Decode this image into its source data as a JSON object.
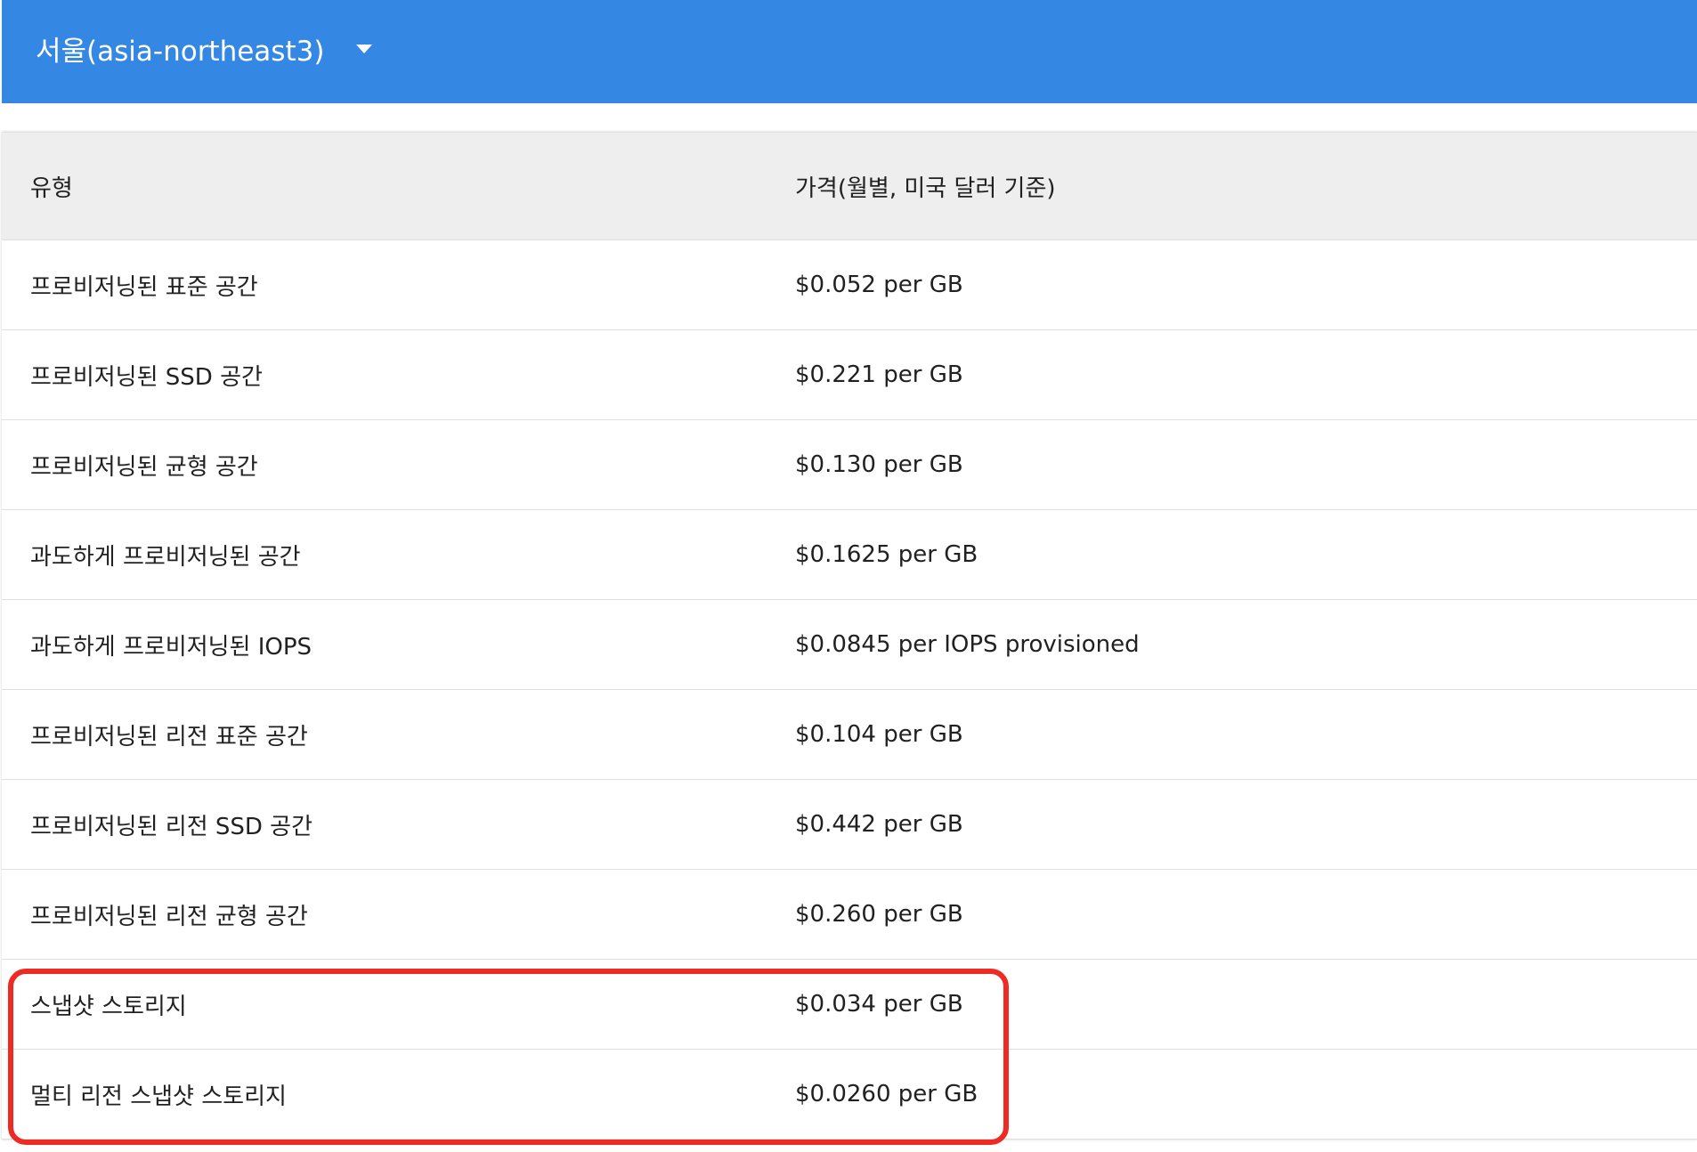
{
  "header": {
    "region": "서울(asia-northeast3)",
    "dropdown_icon": "caret-down-icon"
  },
  "table": {
    "columns": {
      "type": "유형",
      "price": "가격(월별, 미국 달러 기준)"
    },
    "rows": [
      {
        "type": "프로비저닝된 표준 공간",
        "price": "$0.052 per GB"
      },
      {
        "type": "프로비저닝된 SSD 공간",
        "price": "$0.221 per GB"
      },
      {
        "type": "프로비저닝된 균형 공간",
        "price": "$0.130 per GB"
      },
      {
        "type": "과도하게 프로비저닝된 공간",
        "price": "$0.1625 per GB"
      },
      {
        "type": "과도하게 프로비저닝된 IOPS",
        "price": "$0.0845 per IOPS provisioned"
      },
      {
        "type": "프로비저닝된 리전 표준 공간",
        "price": "$0.104 per GB"
      },
      {
        "type": "프로비저닝된 리전 SSD 공간",
        "price": "$0.442 per GB"
      },
      {
        "type": "프로비저닝된 리전 균형 공간",
        "price": "$0.260 per GB"
      },
      {
        "type": "스냅샷 스토리지",
        "price": "$0.034 per GB"
      },
      {
        "type": "멀티 리전 스냅샷 스토리지",
        "price": "$0.0260 per GB"
      }
    ]
  },
  "colors": {
    "header_bg": "#3487e3",
    "table_head_bg": "#eeeeee",
    "highlight": "#ee2a24"
  }
}
